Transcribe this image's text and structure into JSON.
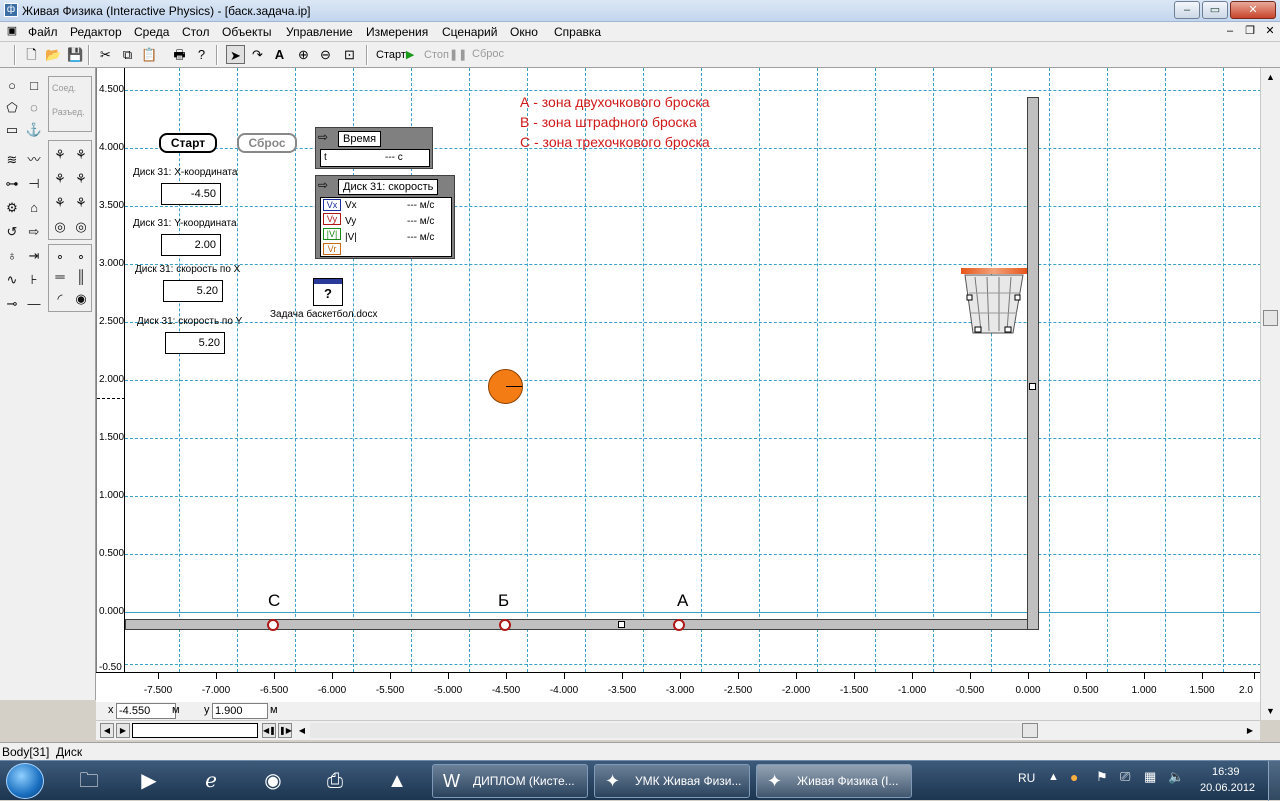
{
  "window": {
    "title": "Живая Физика (Interactive Physics) - [баск.задача.ip]"
  },
  "menu": [
    "Файл",
    "Редактор",
    "Среда",
    "Стол",
    "Объекты",
    "Управление",
    "Измерения",
    "Сценарий",
    "Окно",
    "Справка"
  ],
  "toolbar": {
    "start": "Старт",
    "stop": "Стоп",
    "reset": "Сброс"
  },
  "palette": {
    "join": "Соед.",
    "split": "Разъед."
  },
  "controls": {
    "start_button": "Старт",
    "reset_button": "Сброс",
    "inputs": [
      {
        "label": "Диск 31: X-координата",
        "value": "-4.50"
      },
      {
        "label": "Диск 31: Y-координата",
        "value": "2.00"
      },
      {
        "label": "Диск 31: скорость по X",
        "value": "5.20"
      },
      {
        "label": "Диск 31: скорость по Y",
        "value": "5.20"
      }
    ]
  },
  "time_meter": {
    "title": "Время",
    "var": "t",
    "value": "--- c"
  },
  "velocity_meter": {
    "title": "Диск 31: скорость",
    "rows": [
      {
        "icon": "Vx",
        "name": "Vx",
        "value": "--- м/с"
      },
      {
        "icon": "Vy",
        "name": "Vy",
        "value": "--- м/с"
      },
      {
        "icon": "|V|",
        "name": "|V|",
        "value": "--- м/с"
      },
      {
        "icon": "Vr",
        "name": "",
        "value": ""
      }
    ]
  },
  "doc_label": "Задача баскетбол.docx",
  "doc_icon": "?",
  "legend": [
    "А - зона двухочкового броска",
    "В - зона штрафного броска",
    "С - зона трехочкового броска"
  ],
  "zone_labels": {
    "c": "С",
    "b": "Б",
    "a": "А"
  },
  "y_axis": [
    "4.500",
    "4.000",
    "3.500",
    "3.000",
    "2.500",
    "2.000",
    "1.500",
    "1.000",
    "0.500",
    "0.000",
    "-0.50"
  ],
  "x_axis": [
    "-7.500",
    "-7.000",
    "-6.500",
    "-6.000",
    "-5.500",
    "-5.000",
    "-4.500",
    "-4.000",
    "-3.500",
    "-3.000",
    "-2.500",
    "-2.000",
    "-1.500",
    "-1.000",
    "-0.500",
    "0.000",
    "0.500",
    "1.000",
    "1.500",
    "2.0"
  ],
  "coords": {
    "x_label": "x",
    "x_value": "-4.550",
    "x_unit": "м",
    "y_label": "y",
    "y_value": "1.900",
    "y_unit": "м"
  },
  "status": "Body[31]  Диск",
  "taskbar": {
    "items": [
      "ДИПЛОМ (Кисте...",
      "УМК Живая Физи...",
      "Живая Физика (I..."
    ],
    "lang": "RU",
    "time": "16:39",
    "date": "20.06.2012"
  }
}
